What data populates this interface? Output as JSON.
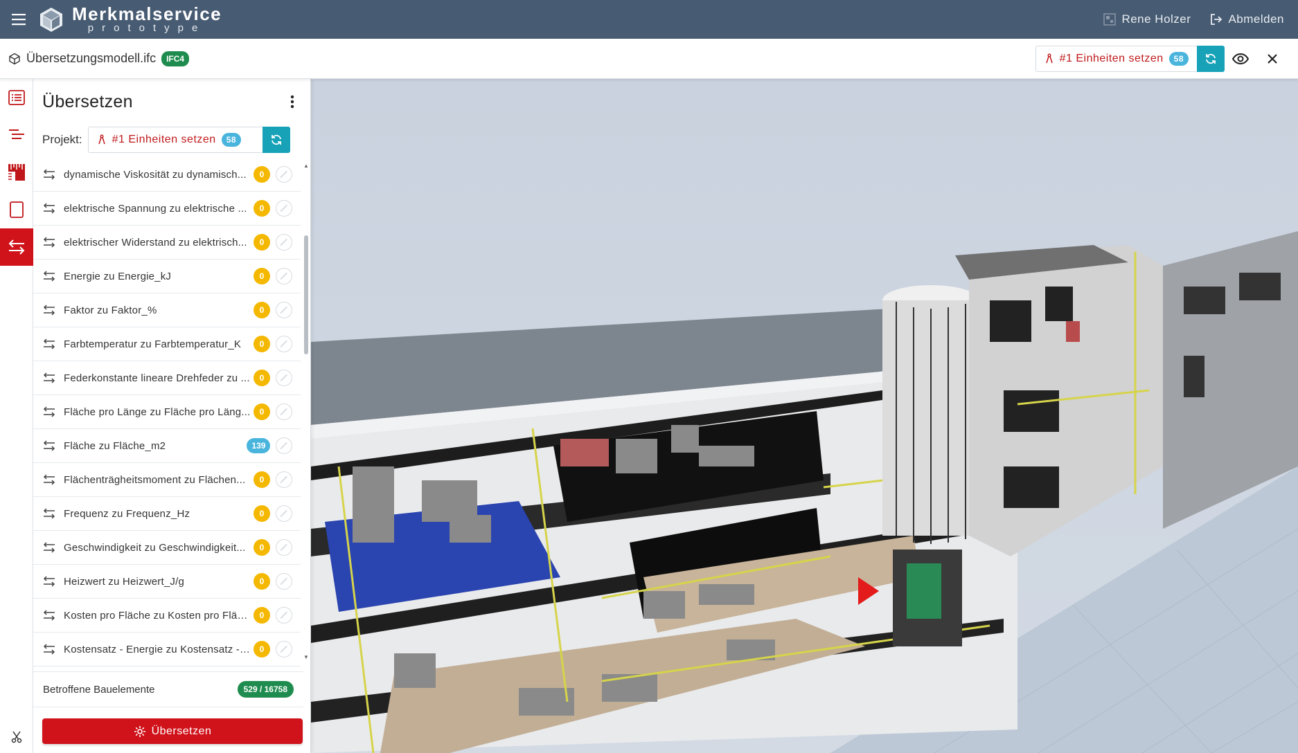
{
  "header": {
    "menu_icon": "hamburger-icon",
    "logo_title": "Merkmalservice",
    "logo_subtitle": "prototype",
    "user_name": "Rene Holzer",
    "logout_label": "Abmelden"
  },
  "subheader": {
    "file_name": "Übersetzungsmodell.ifc",
    "file_badge": "IFC4",
    "project_label": "#1 Einheiten setzen",
    "project_count": "58"
  },
  "leftnav": {
    "items": [
      "list-icon",
      "outline-icon",
      "ruler-icon",
      "book-icon",
      "translate-icon"
    ],
    "active_index": 4
  },
  "panel": {
    "title": "Übersetzen",
    "project_prefix": "Projekt:",
    "project_label": "#1 Einheiten setzen",
    "project_count": "58",
    "rows": [
      {
        "label": "dynamische Viskosität zu dynamisch...",
        "count": "0"
      },
      {
        "label": "elektrische Spannung zu elektrische ...",
        "count": "0"
      },
      {
        "label": "elektrischer Widerstand zu elektrisch...",
        "count": "0"
      },
      {
        "label": "Energie zu Energie_kJ",
        "count": "0"
      },
      {
        "label": "Faktor zu Faktor_%",
        "count": "0"
      },
      {
        "label": "Farbtemperatur zu Farbtemperatur_K",
        "count": "0"
      },
      {
        "label": "Federkonstante lineare Drehfeder zu ...",
        "count": "0"
      },
      {
        "label": "Fläche pro Länge zu Fläche pro Läng...",
        "count": "0"
      },
      {
        "label": "Fläche zu Fläche_m2",
        "count": "139"
      },
      {
        "label": "Flächenträgheitsmoment zu Flächen...",
        "count": "0"
      },
      {
        "label": "Frequenz zu Frequenz_Hz",
        "count": "0"
      },
      {
        "label": "Geschwindigkeit zu Geschwindigkeit...",
        "count": "0"
      },
      {
        "label": "Heizwert zu Heizwert_J/g",
        "count": "0"
      },
      {
        "label": "Kosten pro Fläche zu Kosten pro Fläc...",
        "count": "0"
      },
      {
        "label": "Kostensatz - Energie zu Kostensatz - ...",
        "count": "0"
      }
    ],
    "affected_label": "Betroffene Bauelemente",
    "affected_value": "529 / 16758",
    "translate_button": "Übersetzen"
  },
  "colors": {
    "header_bg": "#475b72",
    "accent_red": "#d0121a",
    "accent_teal": "#17a2b8",
    "badge_yellow": "#f5b800",
    "badge_green": "#1e8c4e",
    "badge_blue": "#4ab5dc"
  }
}
